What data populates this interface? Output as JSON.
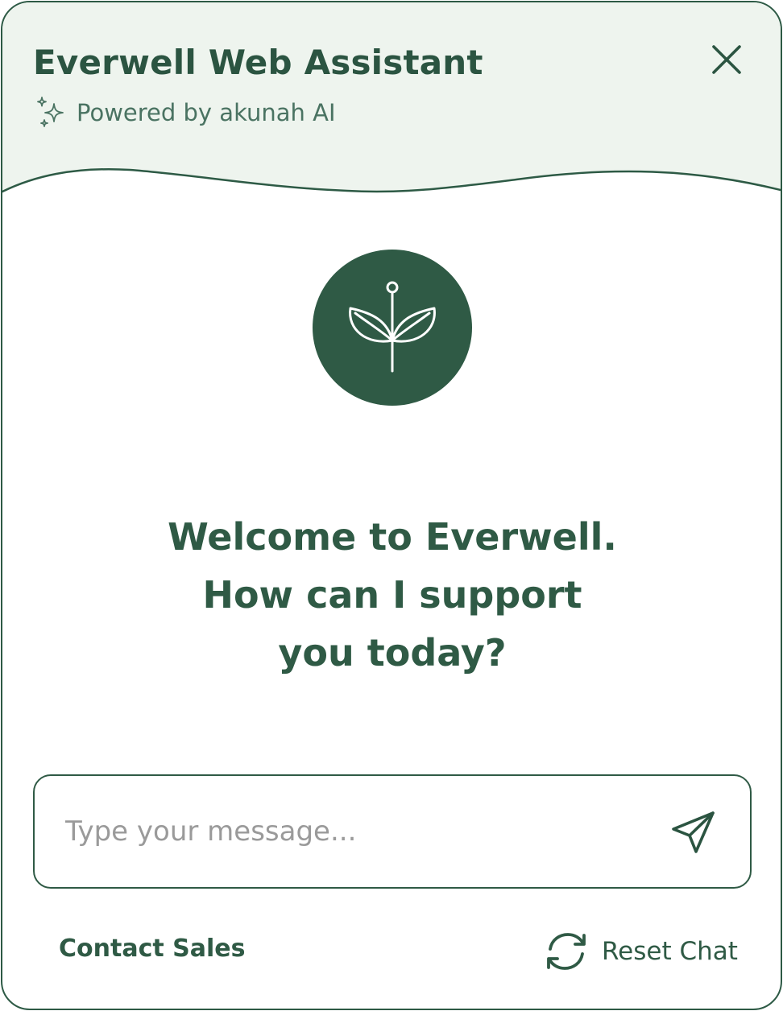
{
  "header": {
    "title": "Everwell Web Assistant",
    "powered_by": "Powered by akunah AI",
    "sparkle_icon": "sparkle-icon",
    "close_icon": "close-icon"
  },
  "logo": {
    "icon": "plant-sprout-icon"
  },
  "welcome": {
    "line1": "Welcome to Everwell.",
    "line2": "How can I support",
    "line3": "you today?"
  },
  "composer": {
    "placeholder": "Type your message...",
    "value": "",
    "send_icon": "send-icon"
  },
  "footer": {
    "contact_sales_label": "Contact Sales",
    "reset_chat_label": "Reset Chat",
    "reset_icon": "refresh-icon"
  },
  "colors": {
    "brand": "#2f5a45",
    "header_bg": "#eef4ee",
    "placeholder": "#9a9a9a"
  }
}
